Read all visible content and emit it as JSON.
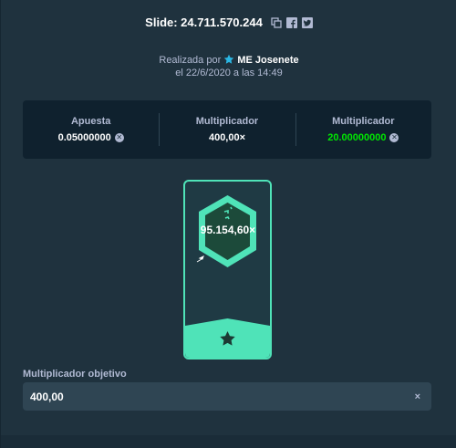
{
  "header": {
    "slide_label": "Slide: 24.711.570.244",
    "icons": [
      "copy-icon",
      "facebook-icon",
      "twitter-icon"
    ]
  },
  "meta": {
    "made_by_prefix": "Realizada por",
    "user": "ME Josenete",
    "date_line": "el 22/6/2020 a las 14:49"
  },
  "stats": [
    {
      "label": "Apuesta",
      "value": "0.05000000"
    },
    {
      "label": "Multiplicador",
      "value": "400,00×"
    },
    {
      "label": "Multiplicador",
      "value": "20.00000000"
    }
  ],
  "card": {
    "multiplier": "95.154,60×",
    "accent": "#4fe3b8"
  },
  "target": {
    "label": "Multiplicador objetivo",
    "value": "400,00",
    "suffix": "×"
  },
  "colors": {
    "background": "#1f323e",
    "panel": "#0f212e",
    "win": "#00e701"
  }
}
